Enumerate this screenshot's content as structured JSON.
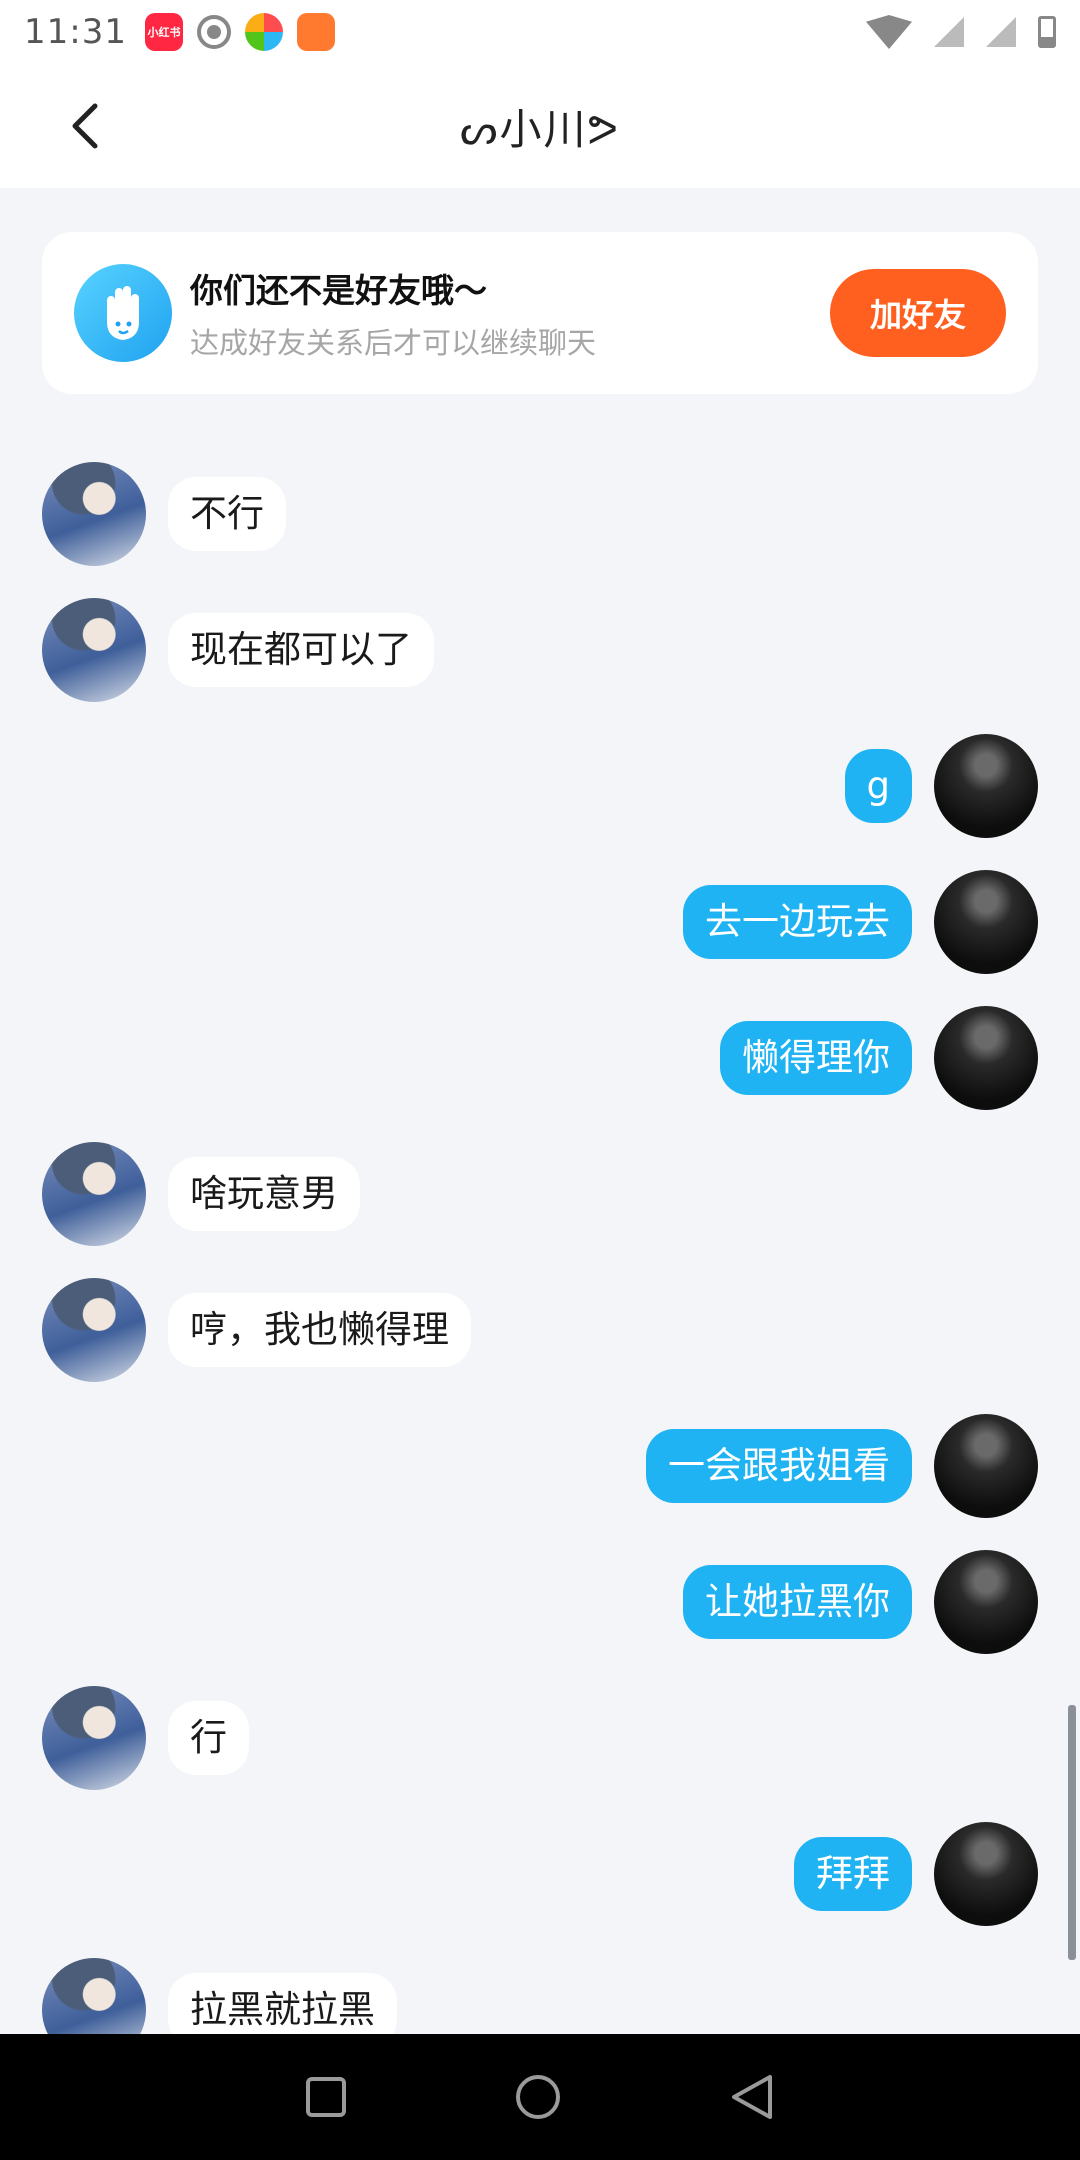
{
  "status_bar": {
    "time": "11:31",
    "apps": [
      "小红书"
    ]
  },
  "header": {
    "title": "ᔕ小川ᕗ"
  },
  "friend_notice": {
    "title": "你们还不是好友哦～",
    "subtitle": "达成好友关系后才可以继续聊天",
    "button_label": "加好友"
  },
  "messages": [
    {
      "side": "in",
      "text": "不行"
    },
    {
      "side": "in",
      "text": "现在都可以了"
    },
    {
      "side": "out",
      "text": "g"
    },
    {
      "side": "out",
      "text": "去一边玩去"
    },
    {
      "side": "out",
      "text": "懒得理你"
    },
    {
      "side": "in",
      "text": "啥玩意男"
    },
    {
      "side": "in",
      "text": "哼，我也懒得理"
    },
    {
      "side": "out",
      "text": "一会跟我姐看"
    },
    {
      "side": "out",
      "text": "让她拉黑你"
    },
    {
      "side": "in",
      "text": "行"
    },
    {
      "side": "out",
      "text": "拜拜"
    },
    {
      "side": "in",
      "text": "拉黑就拉黑"
    }
  ],
  "colors": {
    "accent_blue": "#1fb3f3",
    "add_button": "#ff5f1f"
  }
}
